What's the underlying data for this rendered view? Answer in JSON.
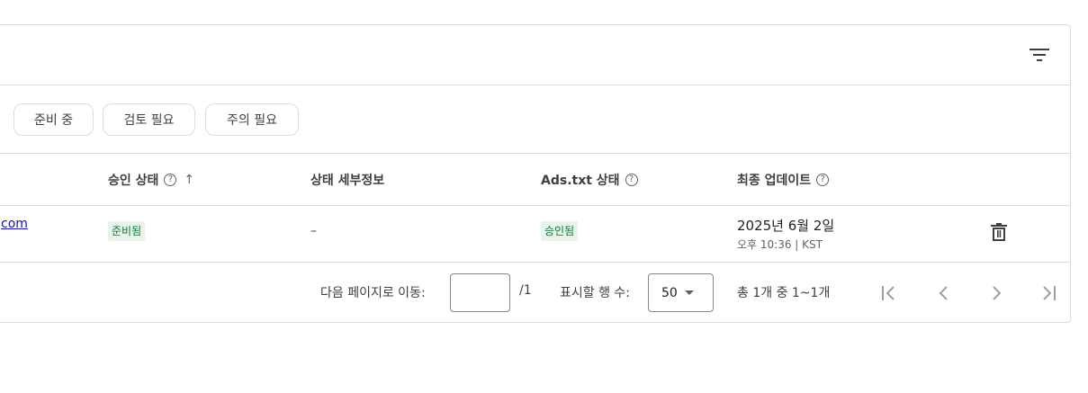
{
  "chips": [
    "준비 중",
    "검토 필요",
    "주의 필요"
  ],
  "columns": {
    "approval": "승인 상태",
    "approval_sort": "↑",
    "details": "상태 세부정보",
    "adstxt": "Ads.txt 상태",
    "updated": "최종 업데이트"
  },
  "help_glyph": "?",
  "row": {
    "site": "com",
    "approval": "준비됨",
    "details": "–",
    "adstxt": "승인됨",
    "date": "2025년 6월 2일",
    "time": "오후 10:36 | KST"
  },
  "footer": {
    "goto_label": "다음 페이지로 이동:",
    "goto_value": "",
    "page_total": "/1",
    "rows_label": "표시할 행 수:",
    "rows_value": "50",
    "range": "총 1개 중 1~1개"
  },
  "colors": {
    "border": "#dadce0",
    "badge_bg": "#e6f4ea",
    "badge_text": "#137333",
    "link": "#1a0dab"
  },
  "icons": [
    "filter-icon",
    "help-icon",
    "trash-icon",
    "first-page-icon",
    "prev-page-icon",
    "next-page-icon",
    "last-page-icon"
  ]
}
